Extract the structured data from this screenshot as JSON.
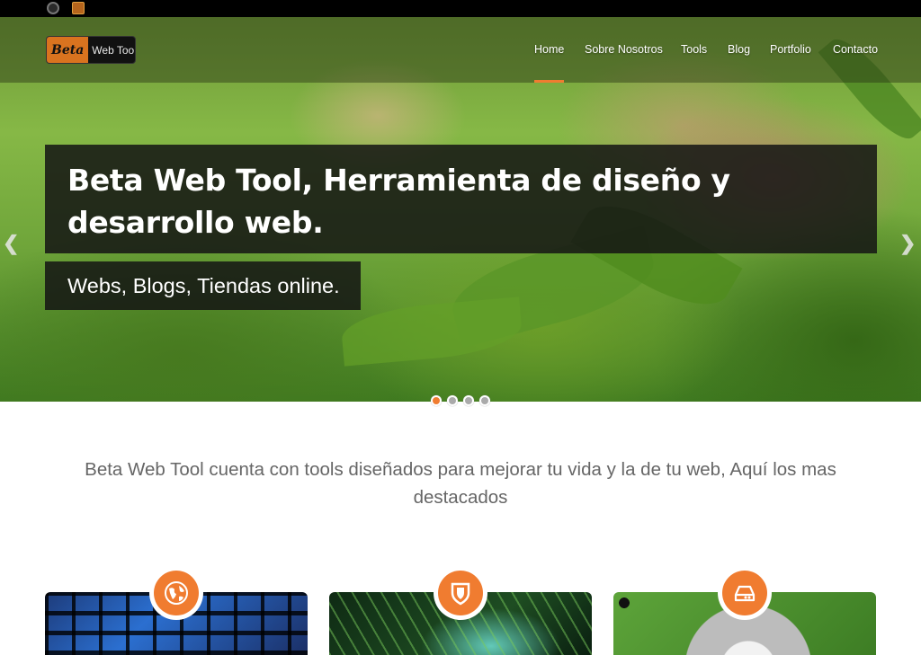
{
  "nav": {
    "logo_part1": "Beta",
    "logo_part2": "Web Tool",
    "items": [
      {
        "label": "Home",
        "active": true
      },
      {
        "label": "Sobre Nosotros"
      },
      {
        "label": "Tools"
      },
      {
        "label": "Blog"
      },
      {
        "label": "Portfolio"
      },
      {
        "label": "Contacto"
      }
    ],
    "active_color": "#f07c30"
  },
  "hero": {
    "title_line1": "Beta Web Tool, Herramienta de diseño y",
    "title_line2": "desarrollo web.",
    "subtitle": "Webs, Blogs, Tiendas online.",
    "prev_icon": "chevron-left-icon",
    "next_icon": "chevron-right-icon",
    "slides": 4,
    "active_slide": 1
  },
  "intro": {
    "text": "Beta Web Tool cuenta con tools diseñados para mejorar tu vida y la de tu web, Aquí los mas destacados"
  },
  "features": [
    {
      "icon": "globe-icon"
    },
    {
      "icon": "shield-icon"
    },
    {
      "icon": "hard-drive-icon"
    }
  ],
  "colors": {
    "accent": "#f07c30",
    "top_bar": "#000000",
    "caption_bg": "#141414"
  }
}
